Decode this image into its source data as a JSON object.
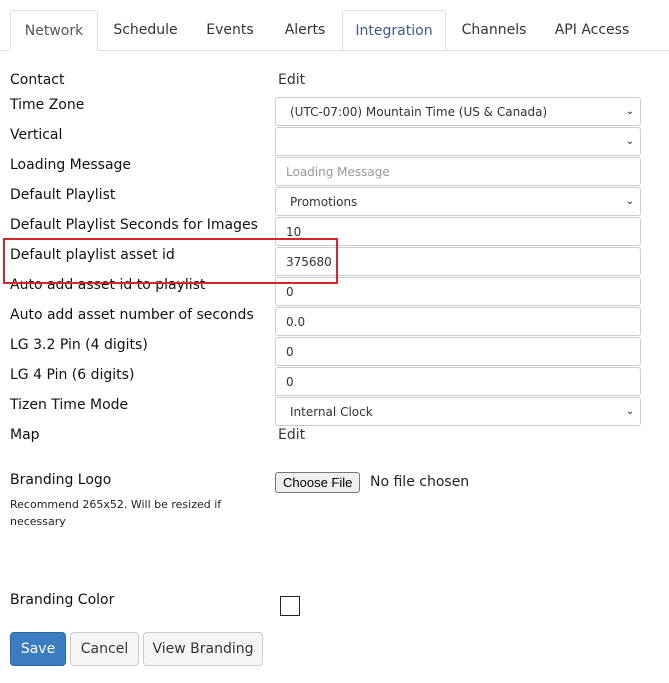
{
  "tabs": [
    {
      "label": "Network"
    },
    {
      "label": "Schedule"
    },
    {
      "label": "Events"
    },
    {
      "label": "Alerts"
    },
    {
      "label": "Integration"
    },
    {
      "label": "Channels"
    },
    {
      "label": "API Access"
    }
  ],
  "form": {
    "contact": {
      "label": "Contact",
      "action": "Edit"
    },
    "time_zone": {
      "label": "Time Zone",
      "value": "(UTC-07:00) Mountain Time (US & Canada)"
    },
    "vertical": {
      "label": "Vertical",
      "value": ""
    },
    "loading_message": {
      "label": "Loading Message",
      "placeholder": "Loading Message",
      "value": ""
    },
    "default_playlist": {
      "label": "Default Playlist",
      "value": "Promotions"
    },
    "default_playlist_seconds": {
      "label": "Default Playlist Seconds for Images",
      "value": "10"
    },
    "default_playlist_asset_id": {
      "label": "Default playlist asset id",
      "value": "375680"
    },
    "auto_add_asset_id": {
      "label": "Auto add asset id to playlist",
      "value": "0"
    },
    "auto_add_asset_seconds": {
      "label": "Auto add asset number of seconds",
      "value": "0.0"
    },
    "lg32_pin": {
      "label": "LG 3.2 Pin (4 digits)",
      "value": "0"
    },
    "lg4_pin": {
      "label": "LG 4 Pin (6 digits)",
      "value": "0"
    },
    "tizen_time_mode": {
      "label": "Tizen Time Mode",
      "value": "Internal Clock"
    },
    "map": {
      "label": "Map",
      "action": "Edit"
    },
    "branding_logo": {
      "label": "Branding Logo",
      "hint": "Recommend 265x52. Will be resized if necessary",
      "button": "Choose File",
      "status": "No file chosen"
    },
    "branding_color": {
      "label": "Branding Color"
    }
  },
  "actions": {
    "save": "Save",
    "cancel": "Cancel",
    "view_branding": "View Branding"
  },
  "colors": {
    "primary": "#3a7dc1",
    "highlight_border": "#d9232e",
    "tab_highlight_text": "#3c5a8a"
  }
}
